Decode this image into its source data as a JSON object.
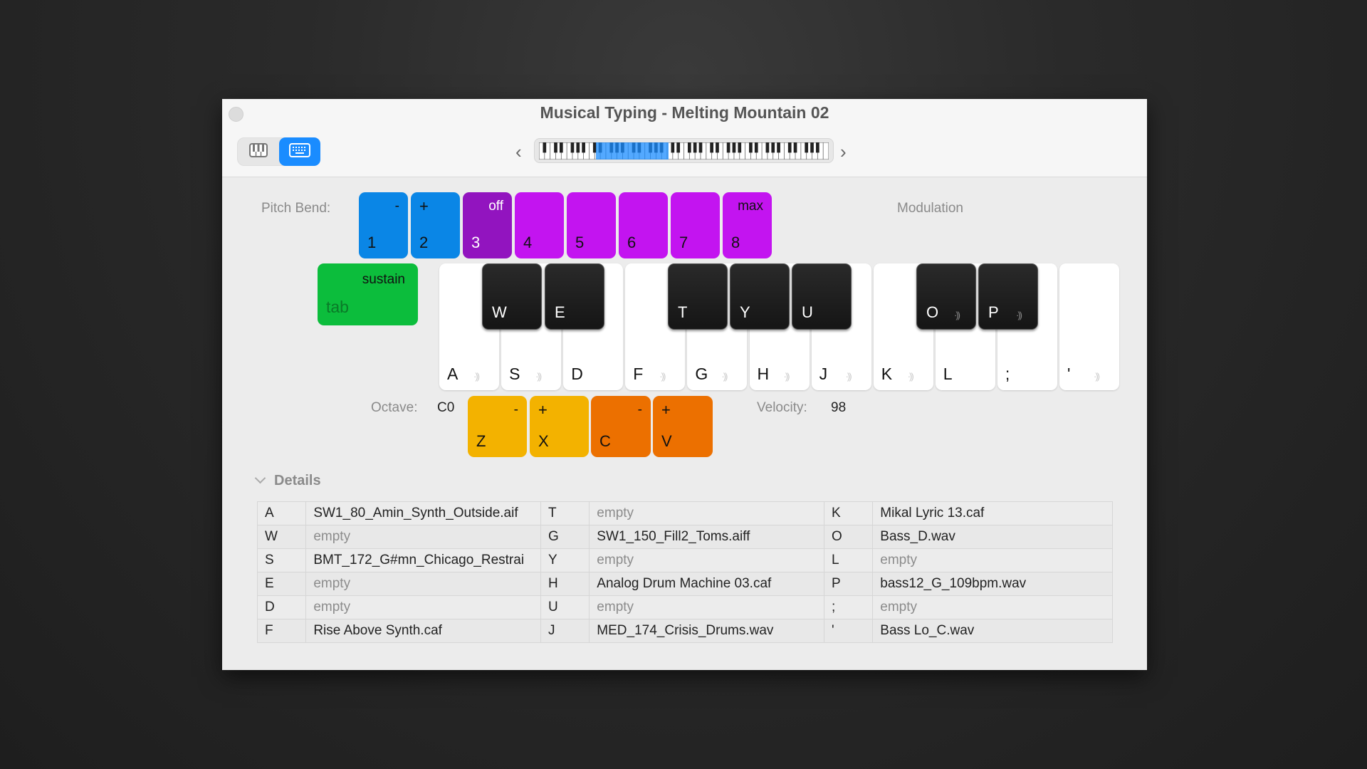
{
  "window": {
    "title": "Musical Typing - Melting Mountain 02"
  },
  "toolbar": {
    "view_toggle": [
      {
        "icon": "piano-keyboard-icon",
        "active": false
      },
      {
        "icon": "computer-keyboard-icon",
        "active": true
      }
    ],
    "prev_label": "‹",
    "next_label": "›"
  },
  "pitch_bend": {
    "label": "Pitch Bend:",
    "value": "0"
  },
  "modulation": {
    "label": "Modulation"
  },
  "number_keys": [
    {
      "key": "1",
      "top": "-",
      "color": "#0a86e6"
    },
    {
      "key": "2",
      "top_left": "+",
      "color": "#0a86e6"
    },
    {
      "key": "3",
      "top": "off",
      "color": "#9214bf"
    },
    {
      "key": "4",
      "top": "",
      "color": "#c314f0"
    },
    {
      "key": "5",
      "top": "",
      "color": "#c314f0"
    },
    {
      "key": "6",
      "top": "",
      "color": "#c314f0"
    },
    {
      "key": "7",
      "top": "",
      "color": "#c314f0"
    },
    {
      "key": "8",
      "top": "max",
      "color": "#c314f0"
    }
  ],
  "sustain": {
    "top": "sustain",
    "key": "tab",
    "color": "#0cbd3c"
  },
  "white_keys": [
    {
      "key": "A",
      "sound": true
    },
    {
      "key": "S",
      "sound": true
    },
    {
      "key": "D",
      "sound": false
    },
    {
      "key": "F",
      "sound": true
    },
    {
      "key": "G",
      "sound": true
    },
    {
      "key": "H",
      "sound": true
    },
    {
      "key": "J",
      "sound": true
    },
    {
      "key": "K",
      "sound": true
    },
    {
      "key": "L",
      "sound": false
    },
    {
      "key": ";",
      "sound": false
    },
    {
      "key": "'",
      "sound": true
    }
  ],
  "black_keys": [
    {
      "key": "W",
      "sound": false
    },
    {
      "key": "E",
      "sound": false
    },
    {
      "key": "T",
      "sound": false
    },
    {
      "key": "Y",
      "sound": false
    },
    {
      "key": "U",
      "sound": false
    },
    {
      "key": "O",
      "sound": true
    },
    {
      "key": "P",
      "sound": true
    }
  ],
  "sound_glyph": "·))",
  "octave": {
    "label": "Octave:",
    "value": "C0",
    "keys": [
      {
        "key": "Z",
        "top": "-"
      },
      {
        "key": "X",
        "top_left": "+"
      }
    ]
  },
  "velocity": {
    "label": "Velocity:",
    "value": "98",
    "keys": [
      {
        "key": "C",
        "top": "-"
      },
      {
        "key": "V",
        "top_left": "+"
      }
    ]
  },
  "details": {
    "label": "Details",
    "rows": [
      [
        {
          "k": "A",
          "f": "SW1_80_Amin_Synth_Outside.aif"
        },
        {
          "k": "T",
          "f": "empty"
        },
        {
          "k": "K",
          "f": "Mikal Lyric 13.caf"
        }
      ],
      [
        {
          "k": "W",
          "f": "empty"
        },
        {
          "k": "G",
          "f": "SW1_150_Fill2_Toms.aiff"
        },
        {
          "k": "O",
          "f": "Bass_D.wav"
        }
      ],
      [
        {
          "k": "S",
          "f": "BMT_172_G#mn_Chicago_Restrai"
        },
        {
          "k": "Y",
          "f": "empty"
        },
        {
          "k": "L",
          "f": "empty"
        }
      ],
      [
        {
          "k": "E",
          "f": "empty"
        },
        {
          "k": "H",
          "f": "Analog Drum Machine 03.caf"
        },
        {
          "k": "P",
          "f": "bass12_G_109bpm.wav"
        }
      ],
      [
        {
          "k": "D",
          "f": "empty"
        },
        {
          "k": "U",
          "f": "empty"
        },
        {
          "k": ";",
          "f": "empty"
        }
      ],
      [
        {
          "k": "F",
          "f": "Rise Above Synth.caf"
        },
        {
          "k": "J",
          "f": "MED_174_Crisis_Drums.wav"
        },
        {
          "k": "'",
          "f": "Bass Lo_C.wav"
        }
      ]
    ]
  }
}
